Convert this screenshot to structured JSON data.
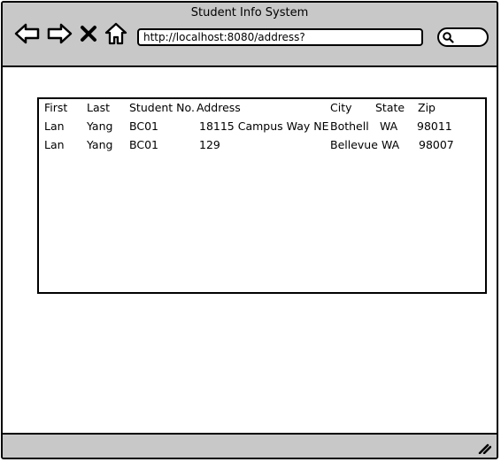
{
  "window": {
    "title": "Student Info System"
  },
  "toolbar": {
    "url": "http://localhost:8080/address?",
    "icons": [
      "back-arrow-icon",
      "forward-arrow-icon",
      "close-x-icon",
      "home-icon",
      "search-icon"
    ]
  },
  "table": {
    "columns": [
      "First",
      "Last",
      "Student No.",
      "Address",
      "City",
      "State",
      "Zip"
    ],
    "rows": [
      [
        "Lan",
        "Yang",
        "BC01",
        "18115 Campus Way NE",
        "Bothell",
        "WA",
        "98011"
      ],
      [
        "Lan",
        "Yang",
        "BC01",
        "129",
        "Bellevue",
        "WA",
        "98007"
      ]
    ]
  }
}
